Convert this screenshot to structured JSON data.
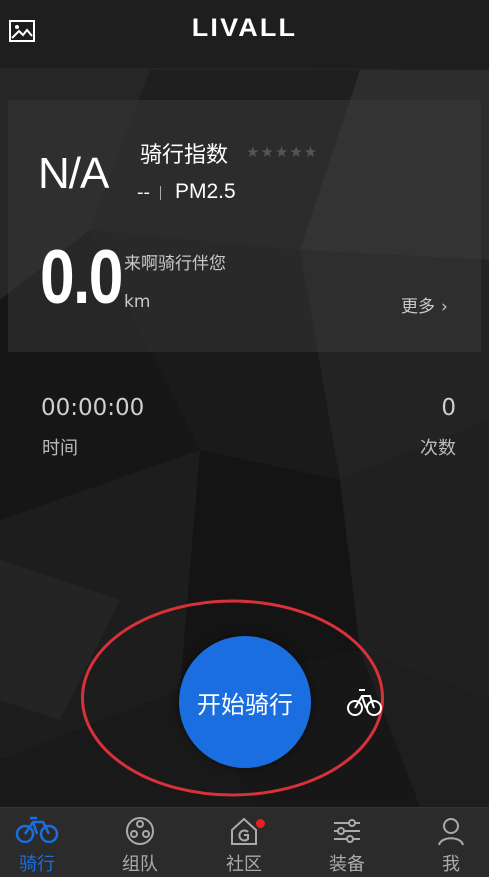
{
  "header": {
    "logo": "LIVALL"
  },
  "card": {
    "index_value": "N/A",
    "index_label": "骑行指数",
    "stars": "★★★★★",
    "aqi_value": "--",
    "aqi_label": "PM2.5",
    "distance": "0.0",
    "motto": "来啊骑行伴您",
    "distance_unit": "km",
    "more": "更多"
  },
  "stats": {
    "time_value": "00:00:00",
    "time_label": "时间",
    "count_value": "0",
    "count_label": "次数"
  },
  "start_button": "开始骑行",
  "tabs": [
    {
      "label": "骑行",
      "icon": "bike-icon",
      "active": true
    },
    {
      "label": "组队",
      "icon": "team-icon"
    },
    {
      "label": "社区",
      "icon": "community-icon",
      "badge": true
    },
    {
      "label": "装备",
      "icon": "equipment-icon"
    },
    {
      "label": "我",
      "icon": "person-icon"
    }
  ],
  "colors": {
    "accent": "#1a6ee0",
    "annotation": "#d8313a",
    "badge": "#e82020"
  }
}
